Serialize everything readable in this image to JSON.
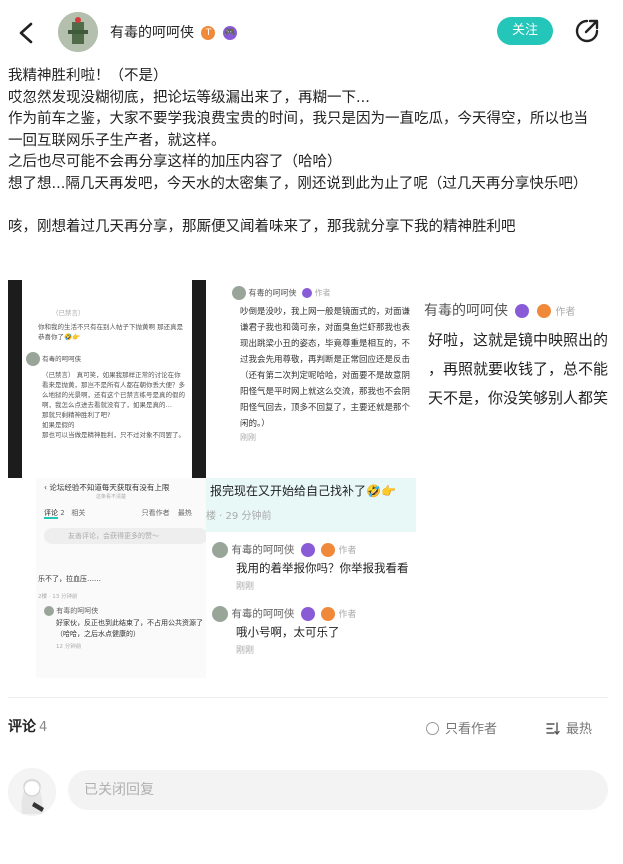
{
  "header": {
    "username": "有毒的呵呵侠",
    "badge1": "T",
    "badge2": "🎮",
    "follow_label": "关注"
  },
  "post": {
    "lines": [
      "我精神胜利啦！（不是）",
      "哎忽然发现没糊彻底，把论坛等级漏出来了，再糊一下...",
      "作为前车之鉴，大家不要学我浪费宝贵的时间，我只是因为一直吃瓜，今天得空，所以也当",
      "一回互联网乐子生产者，就这样。",
      "之后也尽可能不会再分享这样的加压内容了（哈哈）",
      "想了想...隔几天再发吧，今天水的太密集了，刚还说到此为止了呢（过几天再分享快乐吧）",
      "",
      "咳，刚想着过几天再分享，那厮便又闻着味来了，那我就分享下我的精神胜利吧"
    ]
  },
  "screenshots": {
    "s1": {
      "t1": "（已禁言）",
      "t2": "你和我的生活不只有在别人帖子下抛黄啊 那还真是恭喜你了🤣👉",
      "name": "有毒的呵呵侠",
      "t3": "（已禁言）  真可笑，如果我那样正常的讨论在你看来是抛黄，那岂不是所有人都在朝你丢大便？多么地狱的光景啊，还有这个已禁言练号是真的假的啊，我怎么点进去看就没有了，如果是真的…",
      "t4": "那就只剩精神胜利了吧?",
      "t5": "如果是假的",
      "t6": "那也可以当做是精神胜利，只不过对象不同罢了。"
    },
    "s2": {
      "name": "有毒的呵呵侠",
      "tag": "作者",
      "body": "吵倒是没吵，我上网一般是镜面式的，对面谦谦君子我也和蔼可亲，对面臭鱼烂虾那我也表现出跳梁小丑的姿态，毕竟尊重是相互的，不过我会先用尊敬，再判断是正常回应还是反击（还有第二次判定呢哈哈，对面要不是故意阴阳怪气是平时网上就这么交流，那我也不会阴阳怪气回去，顶多不回复了，主要还就是那个闲的。）",
      "time": "刚刚"
    },
    "s3": {
      "name": "有毒的呵呵侠",
      "tag": "作者",
      "l1": "好啦，这就是镜中映照出的",
      "l2": "，再照就要收钱了，总不能",
      "l3": "天不是，你没笑够别人都笑"
    },
    "s4": {
      "title": "论坛经验不知道每天获取有没有上限",
      "sub": "这条看不清楚",
      "tab1": "评论",
      "tab1n": "2",
      "tab2": "相关",
      "only": "只看作者",
      "hot": "最热",
      "placeholder": "友善评论，会获得更多的赞～",
      "c1": "乐不了，拉血压……",
      "c1meta": "2楼 · 13 分钟前",
      "name": "有毒的呵呵侠",
      "c2": "好家伙，反正也到此结束了，不占用公共资源了（哈哈，之后水点健康的）",
      "c2meta": "12 分钟前"
    },
    "s5": {
      "text": "报完现在又开始给自己找补了🤣👉",
      "meta": "楼 · 29 分钟前"
    },
    "s6": {
      "name1": "有毒的呵呵侠",
      "tag": "作者",
      "c1": "我用的着举报你吗？你举报我看看",
      "t1": "刚刚",
      "name2": "有毒的呵呵侠",
      "c2": "哦小号啊，太可乐了",
      "t2": "刚刚"
    }
  },
  "comments": {
    "title": "评论",
    "count": "4",
    "only_author": "只看作者",
    "sort": "最热",
    "reply_placeholder": "已关闭回复"
  },
  "colors": {
    "accent": "#23c6b8",
    "badge_orange": "#f08a3a",
    "badge_purple": "#8a5bd6"
  }
}
